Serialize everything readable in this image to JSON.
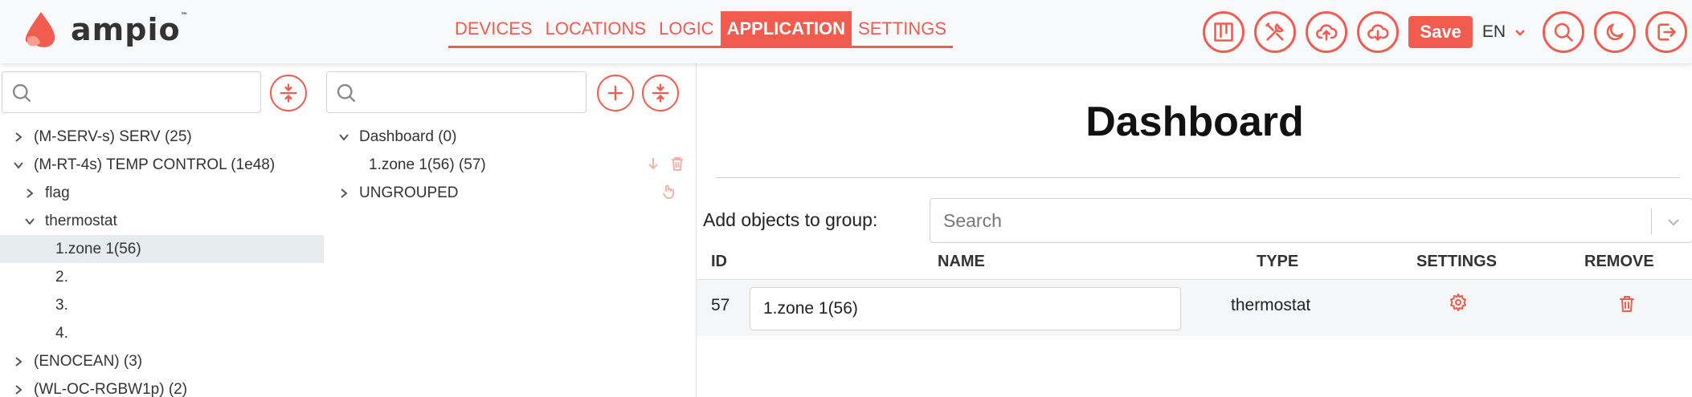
{
  "brand": {
    "name": "ampio",
    "tm": "™"
  },
  "nav": {
    "items": [
      {
        "label": "DEVICES"
      },
      {
        "label": "LOCATIONS"
      },
      {
        "label": "LOGIC"
      },
      {
        "label": "APPLICATION",
        "active": true
      },
      {
        "label": "SETTINGS"
      }
    ]
  },
  "toolbar": {
    "save_label": "Save",
    "language": "EN",
    "icons": [
      "board-icon",
      "tools-icon",
      "cloud-upload-icon",
      "cloud-download-icon",
      "search-icon",
      "moon-icon",
      "logout-icon"
    ]
  },
  "device_tree": {
    "search_placeholder": "",
    "rows": [
      {
        "label": "(M-SERV-s) SERV (25)",
        "level": 0,
        "expanded": false
      },
      {
        "label": "(M-RT-4s) TEMP CONTROL (1e48)",
        "level": 0,
        "expanded": true
      },
      {
        "label": "flag",
        "level": 1,
        "expanded": false
      },
      {
        "label": "thermostat",
        "level": 1,
        "expanded": true
      },
      {
        "label": "1.zone 1(56)",
        "level": 2,
        "selected": true
      },
      {
        "label": "2.",
        "level": 2
      },
      {
        "label": "3.",
        "level": 2
      },
      {
        "label": "4.",
        "level": 2
      },
      {
        "label": "(ENOCEAN) (3)",
        "level": 0,
        "expanded": false
      },
      {
        "label": "(WL-OC-RGBW1p) (2)",
        "level": 0,
        "expanded": false
      }
    ]
  },
  "group_tree": {
    "search_placeholder": "",
    "rows": [
      {
        "label": "Dashboard (0)",
        "expanded": true
      },
      {
        "label": "1.zone 1(56) (57)",
        "child": true
      },
      {
        "label": "UNGROUPED",
        "expanded": false
      }
    ]
  },
  "main": {
    "title": "Dashboard",
    "add_label": "Add objects to group:",
    "search_placeholder": "Search",
    "columns": {
      "id": "ID",
      "name": "NAME",
      "type": "TYPE",
      "settings": "SETTINGS",
      "remove": "REMOVE"
    },
    "rows": [
      {
        "id": "57",
        "name": "1.zone 1(56)",
        "type": "thermostat"
      }
    ]
  },
  "colors": {
    "accent": "#f25c4e",
    "header_bg": "#f8f9fa",
    "selected_row": "#e8ebee"
  }
}
